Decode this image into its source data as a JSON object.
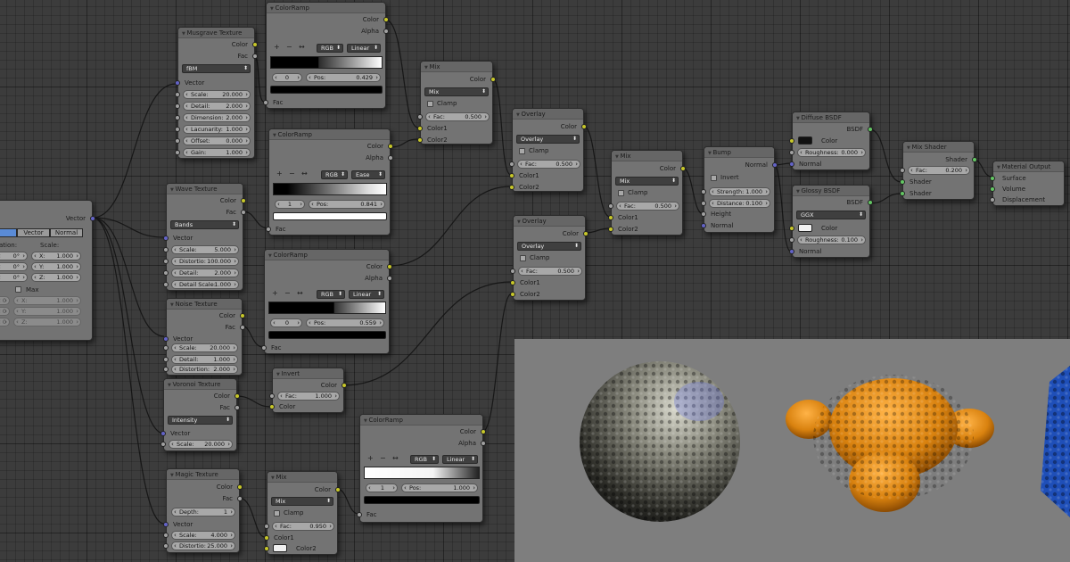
{
  "coord": {
    "out_vector": "Vector",
    "tab_vector": "Vector",
    "tab_normal": "Normal",
    "label_location": "ation:",
    "label_scale": "Scale:",
    "rot": [
      "0°",
      "0°",
      "0°"
    ],
    "scale": [
      {
        "l": "X:",
        "v": "1.000"
      },
      {
        "l": "Y:",
        "v": "1.000"
      },
      {
        "l": "Z:",
        "v": "1.000"
      }
    ],
    "max_label": "Max",
    "max_vals": [
      {
        "l": "X:",
        "v": "1.000"
      },
      {
        "l": "Y:",
        "v": "1.000"
      },
      {
        "l": "Z:",
        "v": "1.000"
      }
    ],
    "min_vals": [
      "0",
      "0",
      "0"
    ]
  },
  "musgrave": {
    "title": "Musgrave Texture",
    "out1": "Color",
    "out2": "Fac",
    "type": "fBM",
    "in_vector": "Vector",
    "fields": [
      {
        "l": "Scale:",
        "v": "20.000"
      },
      {
        "l": "Detail:",
        "v": "2.000"
      },
      {
        "l": "Dimension:",
        "v": "2.000"
      },
      {
        "l": "Lacunarity:",
        "v": "1.000"
      },
      {
        "l": "Offset:",
        "v": "0.000"
      },
      {
        "l": "Gain:",
        "v": "1.000"
      }
    ]
  },
  "ramp1": {
    "title": "ColorRamp",
    "out1": "Color",
    "out2": "Alpha",
    "mode": "RGB",
    "interp": "Linear",
    "index": "0",
    "pos_label": "Pos:",
    "pos": "0.429",
    "in": "Fac"
  },
  "ramp2": {
    "title": "ColorRamp",
    "out1": "Color",
    "out2": "Alpha",
    "mode": "RGB",
    "interp": "Ease",
    "index": "1",
    "pos_label": "Pos:",
    "pos": "0.841",
    "in": "Fac"
  },
  "ramp3": {
    "title": "ColorRamp",
    "out1": "Color",
    "out2": "Alpha",
    "mode": "RGB",
    "interp": "Linear",
    "index": "0",
    "pos_label": "Pos:",
    "pos": "0.559",
    "in": "Fac"
  },
  "ramp4": {
    "title": "ColorRamp",
    "out1": "Color",
    "out2": "Alpha",
    "mode": "RGB",
    "interp": "Linear",
    "index": "1",
    "pos_label": "Pos:",
    "pos": "1.000",
    "in": "Fac"
  },
  "wave": {
    "title": "Wave Texture",
    "out1": "Color",
    "out2": "Fac",
    "type": "Bands",
    "in_vector": "Vector",
    "fields": [
      {
        "l": "Scale:",
        "v": "5.000"
      },
      {
        "l": "Distortio:",
        "v": "100.000"
      },
      {
        "l": "Detail:",
        "v": "2.000"
      },
      {
        "l": "Detail Scale:",
        "v": "1.000"
      }
    ]
  },
  "noise": {
    "title": "Noise Texture",
    "out1": "Color",
    "out2": "Fac",
    "in_vector": "Vector",
    "fields": [
      {
        "l": "Scale:",
        "v": "20.000"
      },
      {
        "l": "Detail:",
        "v": "1.000"
      },
      {
        "l": "Distortion:",
        "v": "2.000"
      }
    ]
  },
  "voronoi": {
    "title": "Voronoi Texture",
    "out1": "Color",
    "out2": "Fac",
    "type": "Intensity",
    "in_vector": "Vector",
    "fields": [
      {
        "l": "Scale:",
        "v": "20.000"
      }
    ]
  },
  "magic": {
    "title": "Magic Texture",
    "out1": "Color",
    "out2": "Fac",
    "depth_label": "Depth:",
    "depth": "1",
    "in_vector": "Vector",
    "fields": [
      {
        "l": "Scale:",
        "v": "4.000"
      },
      {
        "l": "Distortio:",
        "v": "25.000"
      }
    ]
  },
  "mix1": {
    "title": "Mix",
    "out": "Color",
    "mode": "Mix",
    "clamp": "Clamp",
    "fac_label": "Fac:",
    "fac": "0.500",
    "in1": "Color1",
    "in2": "Color2"
  },
  "overlay1": {
    "title": "Overlay",
    "out": "Color",
    "mode": "Overlay",
    "clamp": "Clamp",
    "fac_label": "Fac:",
    "fac": "0.500",
    "in1": "Color1",
    "in2": "Color2"
  },
  "overlay2": {
    "title": "Overlay",
    "out": "Color",
    "mode": "Overlay",
    "clamp": "Clamp",
    "fac_label": "Fac:",
    "fac": "0.500",
    "in1": "Color1",
    "in2": "Color2"
  },
  "mix2": {
    "title": "Mix",
    "out": "Color",
    "mode": "Mix",
    "clamp": "Clamp",
    "fac_label": "Fac:",
    "fac": "0.500",
    "in1": "Color1",
    "in2": "Color2"
  },
  "mix3": {
    "title": "Mix",
    "out": "Color",
    "mode": "Mix",
    "clamp": "Clamp",
    "fac_label": "Fac:",
    "fac": "0.950",
    "in1": "Color1",
    "in2": "Color2"
  },
  "invert": {
    "title": "Invert",
    "out": "Color",
    "fac_label": "Fac:",
    "fac": "1.000",
    "in": "Color"
  },
  "bump": {
    "title": "Bump",
    "out": "Normal",
    "invert": "Invert",
    "strength_label": "Strength:",
    "strength": "1.000",
    "distance_label": "Distance:",
    "distance": "0.100",
    "height": "Height",
    "normal": "Normal"
  },
  "diffuse": {
    "title": "Diffuse BSDF",
    "out": "BSDF",
    "color": "Color",
    "rough_label": "Roughness:",
    "rough": "0.000",
    "normal": "Normal"
  },
  "glossy": {
    "title": "Glossy BSDF",
    "out": "BSDF",
    "dist": "GGX",
    "color": "Color",
    "rough_label": "Roughness:",
    "rough": "0.100",
    "normal": "Normal"
  },
  "mixshader": {
    "title": "Mix Shader",
    "out": "Shader",
    "fac_label": "Fac:",
    "fac": "0.200",
    "in1": "Shader",
    "in2": "Shader"
  },
  "output": {
    "title": "Material Output",
    "in1": "Surface",
    "in2": "Volume",
    "in3": "Displacement"
  },
  "colors": {
    "socket_color": "#c7c729",
    "socket_float": "#a1a1a1",
    "socket_vector": "#6363c7",
    "socket_shader": "#63c763",
    "node_body": "#737373",
    "node_header": "#666666",
    "background": "#3c3c3c"
  }
}
